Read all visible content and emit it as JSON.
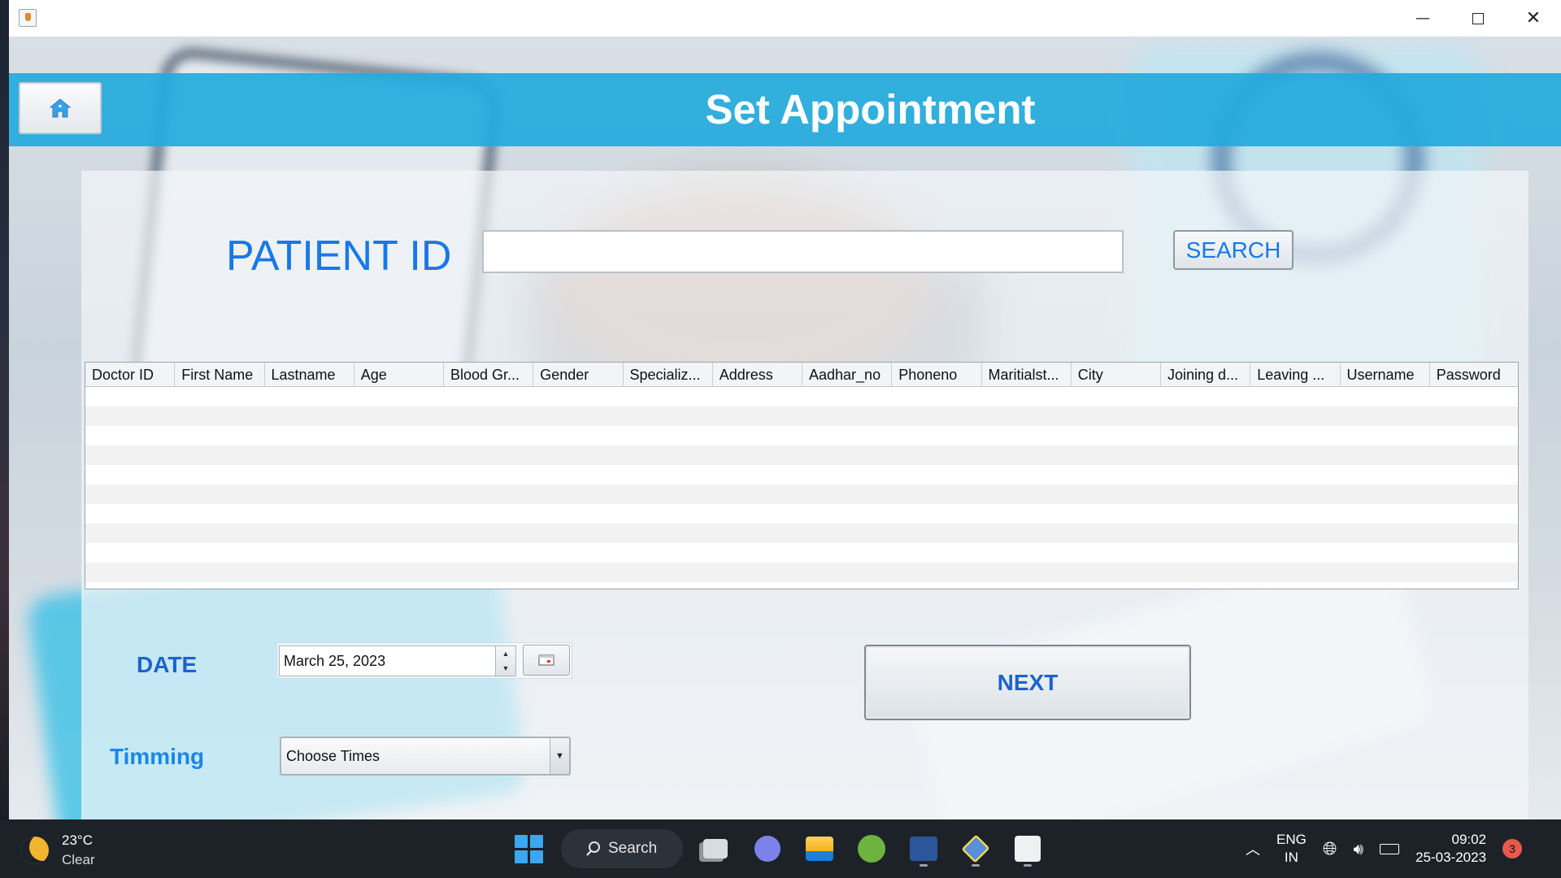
{
  "window": {
    "controls": {
      "minimize": "—",
      "maximize": "",
      "close": "✕"
    }
  },
  "header": {
    "title": "Set Appointment",
    "home_icon": "home-icon"
  },
  "patient": {
    "label": "PATIENT ID",
    "input_value": "",
    "search_label": "SEARCH"
  },
  "table": {
    "columns": [
      "Doctor ID",
      "First Name",
      "Lastname",
      "Age",
      "Blood Gr...",
      "Gender",
      "Specializ...",
      "Address",
      "Aadhar_no",
      "Phoneno",
      "Maritialst...",
      "City",
      "Joining d...",
      "Leaving ...",
      "Username",
      "Password"
    ],
    "rows": []
  },
  "date": {
    "label": "DATE",
    "value": "March 25, 2023",
    "calendar_icon": "calendar-icon"
  },
  "timing": {
    "label": "Timming",
    "value": "Choose Times"
  },
  "next_label": "NEXT",
  "taskbar": {
    "weather_temp": "23°C",
    "weather_condition": "Clear",
    "search_label": "Search",
    "apps": [
      "task-view",
      "teams-chat",
      "file-explorer",
      "spring-tools",
      "word",
      "virtualbox",
      "java"
    ],
    "lang_primary": "ENG",
    "lang_secondary": "IN",
    "time": "09:02",
    "date": "25-03-2023",
    "notification_count": "3"
  },
  "colors": {
    "header_band": "#23aadc",
    "label_blue": "#1878e8",
    "taskbar": "#1d2229"
  }
}
